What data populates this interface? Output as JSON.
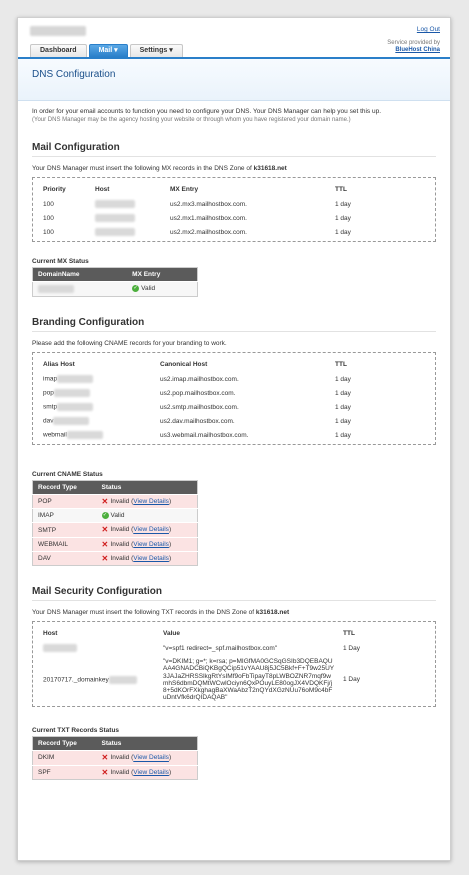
{
  "header": {
    "logout_label": "Log Out",
    "provided_by_label": "Service provided by",
    "provider_name": "BlueHost China",
    "tabs": [
      {
        "label": "Dashboard"
      },
      {
        "label": "Mail ▾"
      },
      {
        "label": "Settings ▾"
      }
    ],
    "page_title": "DNS Configuration"
  },
  "intro": {
    "line1": "In order for your email accounts to function you need to configure your DNS. Your DNS Manager can help you set this up.",
    "line2": "(Your DNS Manager may be the agency hosting your website or through whom you have registered your domain name.)"
  },
  "mail": {
    "title": "Mail Configuration",
    "desc_prefix": "Your DNS Manager must insert the following MX records in the DNS Zone of",
    "zone": "k31618.net",
    "columns": {
      "priority": "Priority",
      "host": "Host",
      "mx": "MX Entry",
      "ttl": "TTL"
    },
    "rows": [
      {
        "priority": "100",
        "mx": "us2.mx3.mailhostbox.com.",
        "ttl": "1 day"
      },
      {
        "priority": "100",
        "mx": "us2.mx1.mailhostbox.com.",
        "ttl": "1 day"
      },
      {
        "priority": "100",
        "mx": "us2.mx2.mailhostbox.com.",
        "ttl": "1 day"
      }
    ],
    "status_title": "Current MX Status",
    "status_columns": {
      "domain": "DomainName",
      "mx": "MX Entry"
    },
    "status_value": "Valid"
  },
  "branding": {
    "title": "Branding Configuration",
    "desc": "Please add the following CNAME records for your branding to work.",
    "columns": {
      "alias": "Alias Host",
      "canonical": "Canonical Host",
      "ttl": "TTL"
    },
    "rows": [
      {
        "alias": "imap",
        "canonical": "us2.imap.mailhostbox.com.",
        "ttl": "1 day"
      },
      {
        "alias": "pop",
        "canonical": "us2.pop.mailhostbox.com.",
        "ttl": "1 day"
      },
      {
        "alias": "smtp",
        "canonical": "us2.smtp.mailhostbox.com.",
        "ttl": "1 day"
      },
      {
        "alias": "dav",
        "canonical": "us2.dav.mailhostbox.com.",
        "ttl": "1 day"
      },
      {
        "alias": "webmail",
        "canonical": "us3.webmail.mailhostbox.com.",
        "ttl": "1 day"
      }
    ],
    "status_title": "Current CNAME Status",
    "status_columns": {
      "type": "Record Type",
      "status": "Status"
    },
    "status_rows": [
      {
        "type": "POP",
        "status": "Invalid",
        "details": "View Details",
        "ok": false
      },
      {
        "type": "IMAP",
        "status": "Valid",
        "details": "",
        "ok": true
      },
      {
        "type": "SMTP",
        "status": "Invalid",
        "details": "View Details",
        "ok": false
      },
      {
        "type": "WEBMAIL",
        "status": "Invalid",
        "details": "View Details",
        "ok": false
      },
      {
        "type": "DAV",
        "status": "Invalid",
        "details": "View Details",
        "ok": false
      }
    ]
  },
  "security": {
    "title": "Mail Security Configuration",
    "desc_prefix": "Your DNS Manager must insert the following TXT records in the DNS Zone of",
    "zone": "k31618.net",
    "columns": {
      "host": "Host",
      "value": "Value",
      "ttl": "TTL"
    },
    "rows": [
      {
        "host": "",
        "value": "\"v=spf1 redirect=_spf.mailhostbox.com\"",
        "ttl": "1 Day"
      },
      {
        "host": "20170717._domainkey",
        "value": "\"v=DKIM1; g=*; k=rsa; p=MIGfMA0GCSqGSIb3DQEBAQUAA4GNADCBiQKBgQCip51vYAAU8j5JC5Bkf+F+T9w25UY3JAJaZHRSSlkgRtYsIMf9oFbTipayT8pLWBOZNR7mqf9wmhS6dbmDQMtWCwlOciyn6QxPOuyLE80ogJX4VDQKFj/j8+5dKOrFXkghagBaXWaAbzT2nQYdXGzNUu76oM9c4bFuDntVfk6drQIDAQAB\"",
        "ttl": "1 Day"
      }
    ],
    "status_title": "Current TXT Records Status",
    "status_columns": {
      "type": "Record Type",
      "status": "Status"
    },
    "status_rows": [
      {
        "type": "DKIM",
        "status": "Invalid",
        "details": "View Details"
      },
      {
        "type": "SPF",
        "status": "Invalid",
        "details": "View Details"
      }
    ]
  },
  "colors": {
    "accent": "#2a7fc9",
    "invalid": "#d01f1f",
    "valid": "#4caf3d"
  }
}
